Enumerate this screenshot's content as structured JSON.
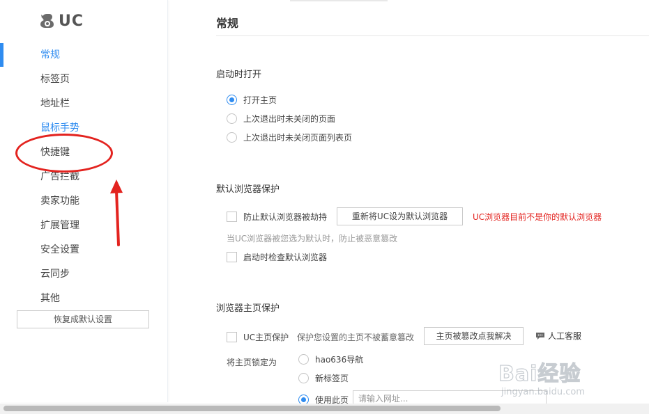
{
  "app": {
    "logo_text": "UC"
  },
  "sidebar": {
    "items": [
      {
        "label": "常规",
        "state": "active"
      },
      {
        "label": "标签页"
      },
      {
        "label": "地址栏"
      },
      {
        "label": "鼠标手势",
        "state": "hover"
      },
      {
        "label": "快捷键"
      },
      {
        "label": "广告拦截"
      },
      {
        "label": "卖家功能"
      },
      {
        "label": "扩展管理"
      },
      {
        "label": "安全设置"
      },
      {
        "label": "云同步"
      },
      {
        "label": "其他"
      }
    ],
    "reset_label": "恢复成默认设置"
  },
  "main": {
    "title": "常规",
    "startup": {
      "title": "启动时打开",
      "options": [
        {
          "label": "打开主页",
          "checked": true
        },
        {
          "label": "上次退出时未关闭的页面",
          "checked": false
        },
        {
          "label": "上次退出时未关闭页面列表页",
          "checked": false
        }
      ]
    },
    "default_browser": {
      "title": "默认浏览器保护",
      "prevent_label": "防止默认浏览器被劫持",
      "set_default_button": "重新将UC设为默认浏览器",
      "warning": "UC浏览器目前不是你的默认浏览器",
      "hint": "当UC浏览器被您选为默认时，防止被恶意篡改",
      "check_on_start_label": "启动时检查默认浏览器"
    },
    "homepage": {
      "title": "浏览器主页保护",
      "protect_label": "UC主页保护",
      "protect_desc": "保护您设置的主页不被蓄意篡改",
      "fix_button": "主页被篡改点我解决",
      "customer_service": "人工客服",
      "lock_label": "将主页锁定为",
      "lock_options": [
        {
          "label": "hao636导航",
          "checked": false
        },
        {
          "label": "新标签页",
          "checked": false
        },
        {
          "label": "使用此页",
          "checked": true
        }
      ],
      "url_placeholder": "请输入网址..."
    }
  },
  "watermark": {
    "brand": "Bai经验",
    "url": "jingyan.baidu.com"
  },
  "colors": {
    "accent": "#2f8cf0",
    "warning": "#e3231f",
    "annotation": "#e3231f"
  }
}
